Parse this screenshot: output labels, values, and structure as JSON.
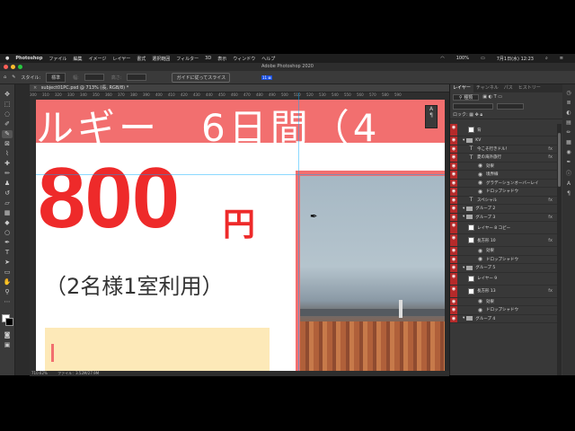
{
  "menubar": {
    "apple": "",
    "app": "Photoshop",
    "menus": [
      "ファイル",
      "編集",
      "イメージ",
      "レイヤー",
      "書式",
      "選択範囲",
      "フィルター",
      "3D",
      "表示",
      "ウィンドウ",
      "ヘルプ"
    ],
    "battery": "100%",
    "date": "7月1日(水) 12:23"
  },
  "window": {
    "title": "Adobe Photoshop 2020"
  },
  "options": {
    "style_label": "スタイル:",
    "style_value": "標準",
    "width_label": "幅:",
    "height_label": "高さ:",
    "guide_button": "ガイドに従ってスライス"
  },
  "document": {
    "tab": "subject01PC.psd @ 713% (長, RGB/8) *",
    "ruler_marks": [
      "300",
      "310",
      "320",
      "330",
      "340",
      "350",
      "360",
      "370",
      "380",
      "390",
      "400",
      "410",
      "420",
      "430",
      "440",
      "450",
      "460",
      "470",
      "480",
      "490",
      "500",
      "510",
      "520",
      "530",
      "540",
      "550",
      "560",
      "570",
      "580",
      "590"
    ],
    "status_zoom": "710.62%",
    "status_file": "ファイル：3.52M/27.9M"
  },
  "canvas": {
    "banner_text": "ルギー　6日間（4",
    "price": "800",
    "yen": "円",
    "persons": "（2名様1室利用）",
    "selection_label": "11 ⊠"
  },
  "panel": {
    "tabs": [
      "レイヤー",
      "チャンネル",
      "パス",
      "ヒストリー"
    ],
    "filter_kind": "種類",
    "lock_label": "ロック:",
    "layers": [
      {
        "name": "背",
        "kind": "thumb",
        "fx": ""
      },
      {
        "name": "KV",
        "kind": "folder",
        "fx": ""
      },
      {
        "name": "今こそ行きドル！",
        "kind": "text",
        "fx": "fx"
      },
      {
        "name": "夏の海外旅行",
        "kind": "text",
        "fx": "fx"
      },
      {
        "name": "効果",
        "kind": "effect",
        "fx": ""
      },
      {
        "name": "境界線",
        "kind": "effect",
        "fx": ""
      },
      {
        "name": "グラデーションオーバーレイ",
        "kind": "effect",
        "fx": ""
      },
      {
        "name": "ドロップシャドウ",
        "kind": "effect",
        "fx": ""
      },
      {
        "name": "スペシャル",
        "kind": "text",
        "fx": "fx"
      },
      {
        "name": "グループ 2",
        "kind": "folder",
        "fx": ""
      },
      {
        "name": "グループ 3",
        "kind": "folder",
        "fx": "fx"
      },
      {
        "name": "レイヤー 8 コピー",
        "kind": "thumb",
        "fx": ""
      },
      {
        "name": "長方形 10",
        "kind": "thumb",
        "fx": "fx"
      },
      {
        "name": "効果",
        "kind": "effect",
        "fx": ""
      },
      {
        "name": "ドロップシャドウ",
        "kind": "effect",
        "fx": ""
      },
      {
        "name": "グループ 5",
        "kind": "folder",
        "fx": ""
      },
      {
        "name": "レイヤー 9",
        "kind": "thumb",
        "fx": ""
      },
      {
        "name": "長方形 13",
        "kind": "thumb",
        "fx": "fx"
      },
      {
        "name": "効果",
        "kind": "effect",
        "fx": ""
      },
      {
        "name": "ドロップシャドウ",
        "kind": "effect",
        "fx": ""
      },
      {
        "name": "グループ 4",
        "kind": "folder",
        "fx": ""
      }
    ]
  }
}
